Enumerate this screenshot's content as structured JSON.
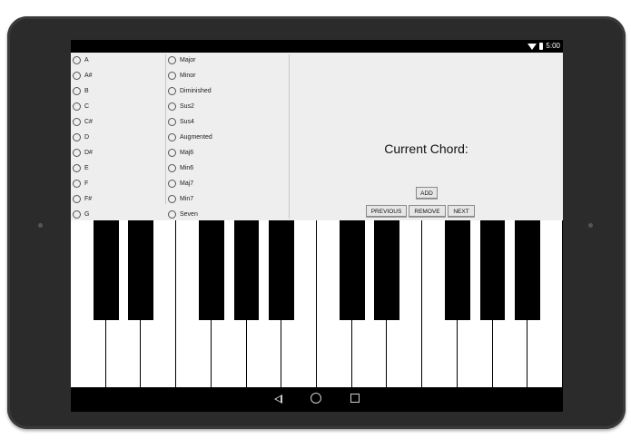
{
  "status_bar": {
    "time": "5:00"
  },
  "notes": [
    "A",
    "A#",
    "B",
    "C",
    "C#",
    "D",
    "D#",
    "E",
    "F",
    "F#",
    "G"
  ],
  "chord_types": [
    "Major",
    "Minor",
    "Diminished",
    "Sus2",
    "Sus4",
    "Augmented",
    "Maj6",
    "Min6",
    "Maj7",
    "Min7",
    "Seven"
  ],
  "chord_panel": {
    "current_chord_label": "Current Chord:",
    "add_label": "ADD",
    "previous_label": "PREVIOUS",
    "remove_label": "REMOVE",
    "next_label": "NEXT"
  },
  "piano": {
    "white_key_count": 14,
    "black_key_count": 10
  },
  "nav_icons": [
    "back-icon",
    "home-icon",
    "recents-icon"
  ],
  "colors": {
    "app_background": "#eeeeee",
    "device_bezel": "#2b2b2b"
  }
}
